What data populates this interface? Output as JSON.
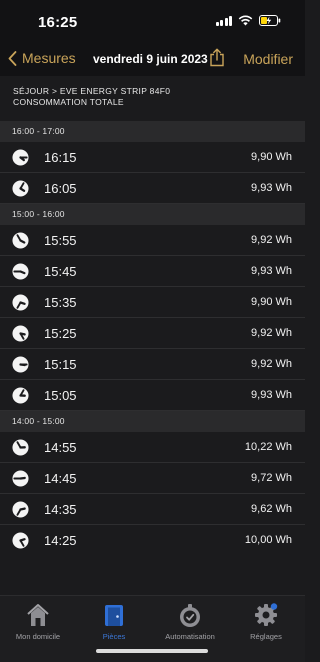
{
  "status_bar": {
    "time": "16:25"
  },
  "nav": {
    "back_label": "Mesures",
    "title": "vendredi 9 juin 2023",
    "edit_label": "Modifier"
  },
  "breadcrumb": {
    "line1": "SÉJOUR > EVE ENERGY STRIP 84F0",
    "line2": "CONSOMMATION TOTALE"
  },
  "sections": [
    {
      "header": "16:00 - 17:00",
      "rows": [
        {
          "time": "16:15",
          "value": "9,90 Wh",
          "minute": 15
        },
        {
          "time": "16:05",
          "value": "9,93 Wh",
          "minute": 5
        }
      ]
    },
    {
      "header": "15:00 - 16:00",
      "rows": [
        {
          "time": "15:55",
          "value": "9,92 Wh",
          "minute": 55
        },
        {
          "time": "15:45",
          "value": "9,93 Wh",
          "minute": 45
        },
        {
          "time": "15:35",
          "value": "9,90 Wh",
          "minute": 35
        },
        {
          "time": "15:25",
          "value": "9,92 Wh",
          "minute": 25
        },
        {
          "time": "15:15",
          "value": "9,92 Wh",
          "minute": 15
        },
        {
          "time": "15:05",
          "value": "9,93 Wh",
          "minute": 5
        }
      ]
    },
    {
      "header": "14:00 - 15:00",
      "rows": [
        {
          "time": "14:55",
          "value": "10,22 Wh",
          "minute": 55
        },
        {
          "time": "14:45",
          "value": "9,72 Wh",
          "minute": 45
        },
        {
          "time": "14:35",
          "value": "9,62 Wh",
          "minute": 35
        },
        {
          "time": "14:25",
          "value": "10,00 Wh",
          "minute": 25
        }
      ]
    }
  ],
  "tabs": [
    {
      "label": "Mon domicile",
      "icon": "house-icon",
      "active": false
    },
    {
      "label": "Pièces",
      "icon": "door-icon",
      "active": true
    },
    {
      "label": "Automatisation",
      "icon": "automation-icon",
      "active": false
    },
    {
      "label": "Réglages",
      "icon": "gear-icon",
      "active": false
    }
  ],
  "colors": {
    "accent": "#c9a45a",
    "active_tab": "#3c78d8",
    "background": "#1b1b1d"
  }
}
